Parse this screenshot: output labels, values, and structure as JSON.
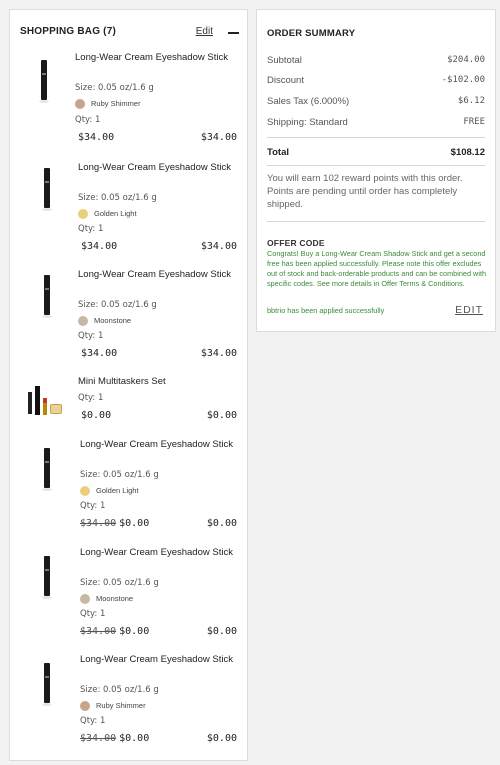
{
  "bag": {
    "title": "SHOPPING BAG (7)",
    "edit_label": "Edit"
  },
  "items": [
    {
      "name": "Long-Wear Cream Eyeshadow Stick",
      "size": "Size: 0.05 oz/1.6 g",
      "shade": "Ruby Shimmer",
      "shade_color": "#c9a48a",
      "qty": "Qty: 1",
      "old_price": "",
      "price": "$34.00",
      "total": "$34.00"
    },
    {
      "name": "Long-Wear Cream Eyeshadow Stick",
      "size": "Size: 0.05 oz/1.6 g",
      "shade": "Golden Light",
      "shade_color": "#e9cf7a",
      "qty": "Qty: 1",
      "old_price": "",
      "price": "$34.00",
      "total": "$34.00"
    },
    {
      "name": "Long-Wear Cream Eyeshadow Stick",
      "size": "Size: 0.05 oz/1.6 g",
      "shade": "Moonstone",
      "shade_color": "#c7b8a6",
      "qty": "Qty: 1",
      "old_price": "",
      "price": "$34.00",
      "total": "$34.00"
    },
    {
      "name": "Mini Multitaskers Set",
      "qty": "Qty: 1",
      "old_price": "",
      "price": "$0.00",
      "total": "$0.00"
    },
    {
      "name": "Long-Wear Cream Eyeshadow Stick",
      "size": "Size: 0.05 oz/1.6 g",
      "shade": "Golden Light",
      "shade_color": "#e9cf7a",
      "qty": "Qty: 1",
      "old_price": "$34.00",
      "price": "$0.00",
      "total": "$0.00"
    },
    {
      "name": "Long-Wear Cream Eyeshadow Stick",
      "size": "Size: 0.05 oz/1.6 g",
      "shade": "Moonstone",
      "shade_color": "#c7b8a6",
      "qty": "Qty: 1",
      "old_price": "$34.00",
      "price": "$0.00",
      "total": "$0.00"
    },
    {
      "name": "Long-Wear Cream Eyeshadow Stick",
      "size": "Size: 0.05 oz/1.6 g",
      "shade": "Ruby Shimmer",
      "shade_color": "#c9a48a",
      "qty": "Qty: 1",
      "old_price": "$34.00",
      "price": "$0.00",
      "total": "$0.00"
    }
  ],
  "summary": {
    "title": "ORDER SUMMARY",
    "subtotal_label": "Subtotal",
    "subtotal": "$204.00",
    "discount_label": "Discount",
    "discount": "-$102.00",
    "tax_label": "Sales Tax (6.000%)",
    "tax": "$6.12",
    "shipping_label": "Shipping: Standard",
    "shipping": "FREE",
    "total_label": "Total",
    "total": "$108.12",
    "reward_text": "You will earn 102 reward points with this order. Points are pending until order has completely shipped.",
    "offer_title": "OFFER CODE",
    "offer_message": "Congrats! Buy a Long-Wear Cream Shadow Stick and get a second free has been applied successfully. Please note this offer excludes out of stock and back-orderable products and can be combined with specific codes. See more details in Offer Terms & Conditions.",
    "applied_text": "bbtrio has been applied successfully",
    "edit_label": "EDIT"
  },
  "colors": {
    "success_green": "#3a8a3a",
    "panel_border": "#dcdcdc",
    "background": "#f2f2f2"
  }
}
